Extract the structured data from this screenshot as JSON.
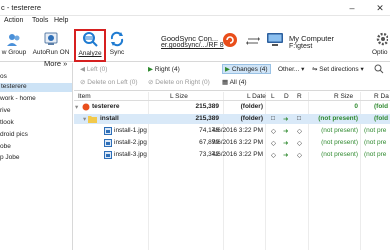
{
  "window": {
    "title": "c - testerere"
  },
  "menu": {
    "action": "Action",
    "tools": "Tools",
    "help": "Help"
  },
  "toolbar": {
    "new_group": "w Group",
    "autorun": "AutoRun ON",
    "analyze": "Analyze",
    "sync": "Sync",
    "options": "Optio",
    "left_title": "GoodSync Con...",
    "left_path": "er.goodsync/.../RF 8",
    "right_title": "My Computer",
    "right_path": "F:\\gtest"
  },
  "sidebar": {
    "more": "More",
    "items": [
      {
        "label": "os",
        "selected": false
      },
      {
        "label": "testerere",
        "selected": true
      },
      {
        "label": "work - home",
        "selected": false
      },
      {
        "label": "rive",
        "selected": false
      },
      {
        "label": "tlook",
        "selected": false
      },
      {
        "label": "droid pics",
        "selected": false
      },
      {
        "label": "obe",
        "selected": false
      },
      {
        "label": "p Jobe",
        "selected": false
      }
    ]
  },
  "filters": {
    "left": "Left (0)",
    "right": "Right (4)",
    "changes": "Changes (4)",
    "other": "Other...",
    "set_dir": "Set directions",
    "delete_left": "Delete on Left (0)",
    "delete_right": "Delete on Right (0)",
    "all": "All (4)"
  },
  "table": {
    "headers": {
      "item": "Item",
      "lsize": "L Size",
      "ldate": "L Date",
      "l": "L",
      "d": "D",
      "rcol": "R",
      "rsize": "R Size",
      "rdate": "R Da"
    },
    "rows": [
      {
        "name": "testerere",
        "lsize": "215,389",
        "ldate": "(folder)",
        "rsize": "0",
        "rdate": "(fold"
      },
      {
        "name": "install",
        "lsize": "215,389",
        "ldate": "(folder)",
        "rsize": "(not present)",
        "rdate": "(fold"
      },
      {
        "name": "install-1.jpg",
        "lsize": "74,148",
        "ldate": "7/6/2016 3:22 PM",
        "rsize": "(not present)",
        "rdate": "(not pre"
      },
      {
        "name": "install-2.jpg",
        "lsize": "67,899",
        "ldate": "7/6/2016 3:22 PM",
        "rsize": "(not present)",
        "rdate": "(not pre"
      },
      {
        "name": "install-3.jpg",
        "lsize": "73,342",
        "ldate": "7/6/2016 3:22 PM",
        "rsize": "(not present)",
        "rdate": "(not pre"
      }
    ]
  },
  "colors": {
    "accent": "#1f7bd1",
    "highlight": "#d62020",
    "added": "#2f8a2f"
  }
}
